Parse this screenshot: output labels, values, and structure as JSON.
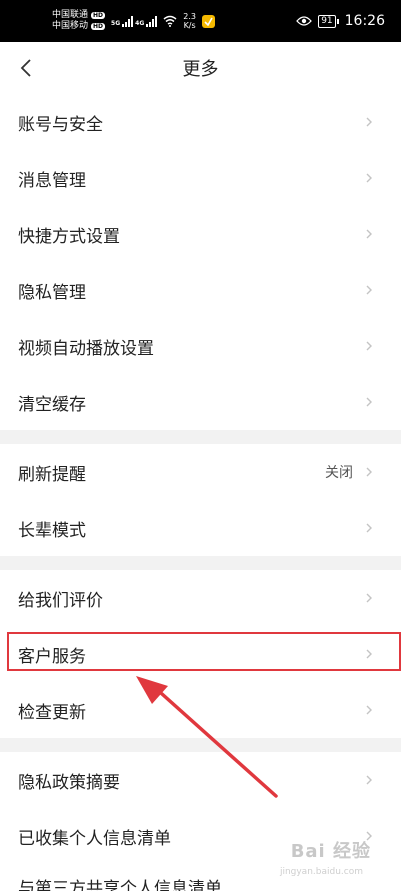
{
  "status_bar": {
    "carrier1": "中国联通",
    "carrier2": "中国移动",
    "hd": "HD",
    "signal1_label": "5G",
    "signal2_label": "4G",
    "speed_value": "2.3",
    "speed_unit": "K/s",
    "battery": "91",
    "time": "16:26"
  },
  "header": {
    "title": "更多"
  },
  "sections": [
    {
      "items": [
        {
          "label": "账号与安全"
        },
        {
          "label": "消息管理"
        },
        {
          "label": "快捷方式设置"
        },
        {
          "label": "隐私管理"
        },
        {
          "label": "视频自动播放设置"
        },
        {
          "label": "清空缓存"
        }
      ]
    },
    {
      "items": [
        {
          "label": "刷新提醒",
          "value": "关闭"
        },
        {
          "label": "长辈模式"
        }
      ]
    },
    {
      "items": [
        {
          "label": "给我们评价"
        },
        {
          "label": "客户服务"
        },
        {
          "label": "检查更新"
        }
      ]
    },
    {
      "items": [
        {
          "label": "隐私政策摘要"
        },
        {
          "label": "已收集个人信息清单"
        },
        {
          "label": "与第三方共享个人信息清单"
        }
      ]
    }
  ],
  "annotation": {
    "highlight_color": "#e0383e"
  },
  "watermark": {
    "text": "Bai 经验",
    "sub": "jingyan.baidu.com"
  }
}
